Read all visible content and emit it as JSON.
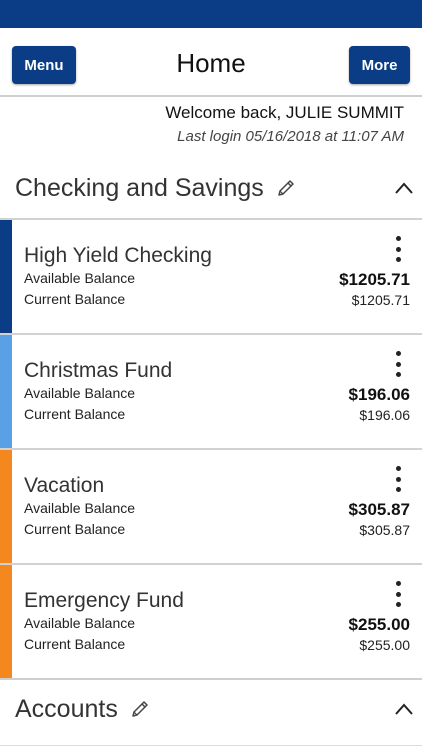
{
  "header": {
    "menu_label": "Menu",
    "title": "Home",
    "more_label": "More",
    "brand_color": "#0b3d86"
  },
  "welcome": {
    "greeting": "Welcome back, JULIE SUMMIT",
    "last_login": "Last login 05/16/2018 at 11:07 AM"
  },
  "sections": {
    "checking": {
      "title": "Checking and Savings",
      "edit_icon": "pencil-icon",
      "collapse_icon": "chevron-up-icon"
    },
    "accounts": {
      "title": "Accounts",
      "edit_icon": "pencil-icon",
      "collapse_icon": "chevron-up-icon"
    }
  },
  "accounts": [
    {
      "name": "High Yield Checking",
      "available_label": "Available Balance",
      "available": "$1205.71",
      "current_label": "Current Balance",
      "current": "$1205.71",
      "color": "#0b3d86",
      "menu_icon": "kebab-icon"
    },
    {
      "name": "Christmas Fund",
      "available_label": "Available Balance",
      "available": "$196.06",
      "current_label": "Current Balance",
      "current": "$196.06",
      "color": "#5aa0e6",
      "menu_icon": "kebab-icon"
    },
    {
      "name": "Vacation",
      "available_label": "Available Balance",
      "available": "$305.87",
      "current_label": "Current Balance",
      "current": "$305.87",
      "color": "#f5871f",
      "menu_icon": "kebab-icon"
    },
    {
      "name": "Emergency Fund",
      "available_label": "Available Balance",
      "available": "$255.00",
      "current_label": "Current Balance",
      "current": "$255.00",
      "color": "#f5871f",
      "menu_icon": "kebab-icon"
    }
  ]
}
